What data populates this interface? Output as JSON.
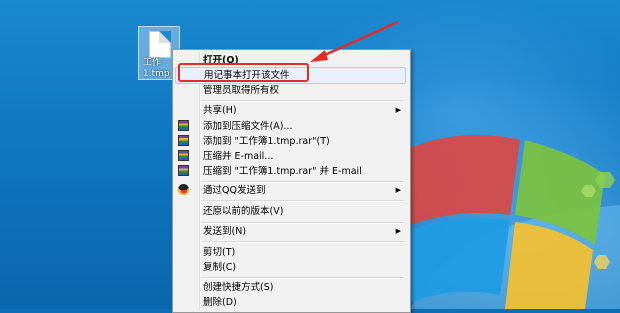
{
  "desktop": {
    "file_label_line1": "工作",
    "file_label_line2": "1.tmp"
  },
  "menu": {
    "open": "打开(O)",
    "open_notepad": "用记事本打开该文件",
    "take_ownership": "管理员取得所有权",
    "share": "共享(H)",
    "add_archive": "添加到压缩文件(A)...",
    "add_to_rar": "添加到 \"工作簿1.tmp.rar\"(T)",
    "compress_email": "压缩并 E-mail...",
    "compress_rar_email": "压缩到 \"工作簿1.tmp.rar\" 并 E-mail",
    "send_qq": "通过QQ发送到",
    "restore_previous": "还原以前的版本(V)",
    "send_to": "发送到(N)",
    "cut": "剪切(T)",
    "copy": "复制(C)",
    "create_shortcut": "创建快捷方式(S)",
    "delete": "删除(D)"
  },
  "colors": {
    "highlight_box": "#e52b24",
    "arrow": "#e52b24"
  }
}
